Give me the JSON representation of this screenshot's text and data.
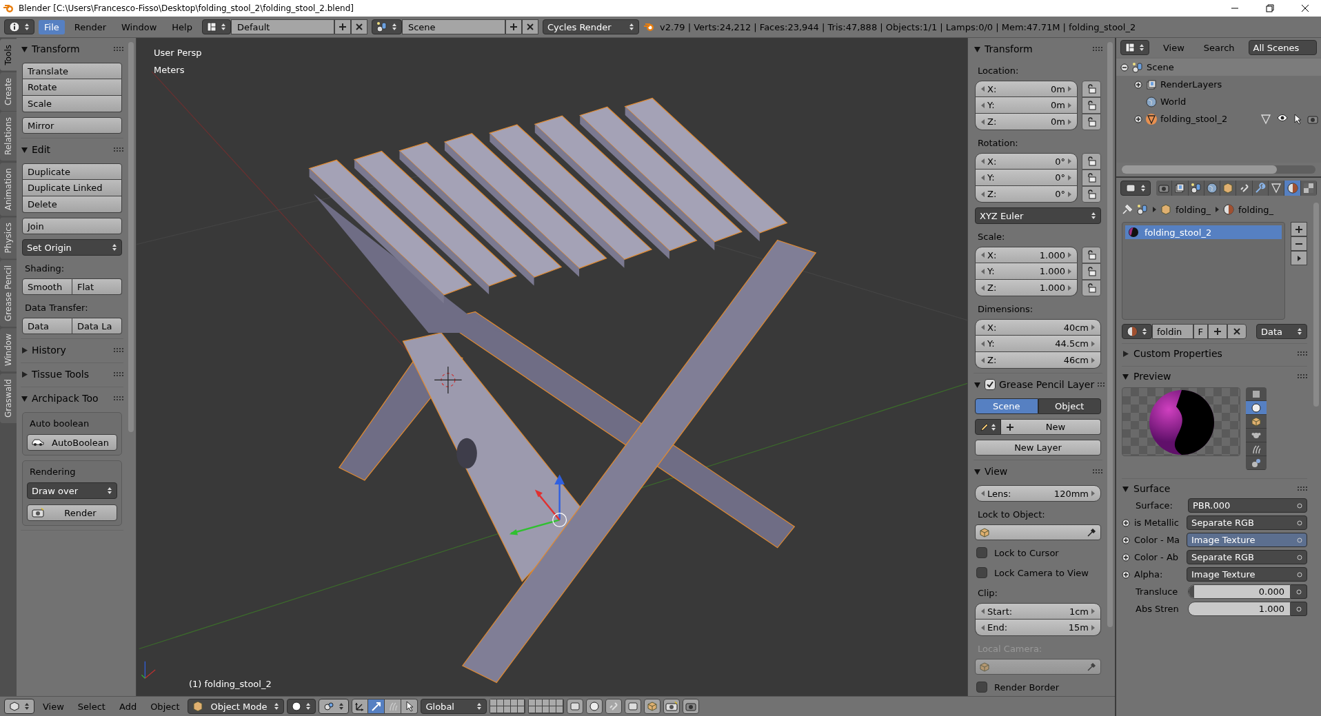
{
  "window": {
    "title": "Blender [C:\\Users\\Francesco-Fisso\\Desktop\\folding_stool_2\\folding_stool_2.blend]"
  },
  "info_header": {
    "menus": [
      {
        "label": "File",
        "selected": true
      },
      {
        "label": "Render",
        "selected": false
      },
      {
        "label": "Window",
        "selected": false
      },
      {
        "label": "Help",
        "selected": false
      }
    ],
    "layout": "Default",
    "scene": "Scene",
    "engine": "Cycles Render",
    "stats": "v2.79 | Verts:24,212 | Faces:23,944 | Tris:47,888 | Objects:1/1 | Lamps:0/0 | Mem:47.71M | folding_stool_2"
  },
  "tool_tabs": [
    {
      "label": "Tools",
      "selected": true
    },
    {
      "label": "Create",
      "selected": false
    },
    {
      "label": "Relations",
      "selected": false
    },
    {
      "label": "Animation",
      "selected": false
    },
    {
      "label": "Physics",
      "selected": false
    },
    {
      "label": "Grease Pencil",
      "selected": false
    },
    {
      "label": "Window",
      "selected": false
    },
    {
      "label": "Graswald",
      "selected": false
    }
  ],
  "tool_panels": [
    {
      "title": "Transform",
      "expanded": true,
      "items": [
        {
          "kind": "buttons",
          "buttons": [
            "Translate",
            "Rotate",
            "Scale"
          ]
        },
        {
          "kind": "buttons",
          "buttons": [
            "Mirror"
          ]
        }
      ]
    },
    {
      "title": "Edit",
      "expanded": true,
      "items": [
        {
          "kind": "buttons",
          "buttons": [
            "Duplicate",
            "Duplicate Linked",
            "Delete"
          ]
        },
        {
          "kind": "buttons",
          "buttons": [
            "Join"
          ]
        },
        {
          "kind": "dropdown",
          "value": "Set Origin"
        },
        {
          "kind": "label",
          "text": "Shading:"
        },
        {
          "kind": "row",
          "buttons": [
            "Smooth",
            "Flat"
          ]
        },
        {
          "kind": "label",
          "text": "Data Transfer:"
        },
        {
          "kind": "row",
          "buttons": [
            "Data",
            "Data La"
          ]
        }
      ]
    },
    {
      "title": "History",
      "expanded": false
    },
    {
      "title": "Tissue Tools",
      "expanded": false
    },
    {
      "title": "Archipack Too",
      "expanded": true,
      "items": [
        {
          "kind": "box",
          "items": [
            {
              "kind": "label",
              "text": "Auto boolean"
            },
            {
              "kind": "boolean_button",
              "label": "AutoBoolean"
            }
          ]
        },
        {
          "kind": "box",
          "items": [
            {
              "kind": "label",
              "text": "Rendering"
            },
            {
              "kind": "dropdown",
              "value": "Draw over"
            },
            {
              "kind": "render_button",
              "label": "Render"
            }
          ]
        }
      ]
    }
  ],
  "viewport": {
    "view_name": "User Persp",
    "units": "Meters",
    "object_label": "(1) folding_stool_2"
  },
  "n_panels": [
    {
      "title": "Transform",
      "expanded": true,
      "items": [
        {
          "kind": "label",
          "text": "Location:",
          "disabled": false
        },
        {
          "kind": "vector",
          "locks": true,
          "fields": [
            {
              "label": "X:",
              "value": "0m"
            },
            {
              "label": "Y:",
              "value": "0m"
            },
            {
              "label": "Z:",
              "value": "0m"
            }
          ]
        },
        {
          "kind": "label",
          "text": "Rotation:",
          "disabled": false
        },
        {
          "kind": "vector",
          "locks": true,
          "fields": [
            {
              "label": "X:",
              "value": "0°"
            },
            {
              "label": "Y:",
              "value": "0°"
            },
            {
              "label": "Z:",
              "value": "0°"
            }
          ]
        },
        {
          "kind": "dropdown",
          "value": "XYZ Euler"
        },
        {
          "kind": "label",
          "text": "Scale:",
          "disabled": false
        },
        {
          "kind": "vector",
          "locks": true,
          "fields": [
            {
              "label": "X:",
              "value": "1.000"
            },
            {
              "label": "Y:",
              "value": "1.000"
            },
            {
              "label": "Z:",
              "value": "1.000"
            }
          ]
        },
        {
          "kind": "label",
          "text": "Dimensions:",
          "disabled": false
        },
        {
          "kind": "vector",
          "locks": false,
          "fields": [
            {
              "label": "X:",
              "value": "40cm"
            },
            {
              "label": "Y:",
              "value": "44.5cm"
            },
            {
              "label": "Z:",
              "value": "46cm"
            }
          ]
        }
      ]
    },
    {
      "title": "Grease Pencil Layer",
      "checked": true,
      "expanded": true,
      "items": [
        {
          "kind": "tabs",
          "tabs": [
            {
              "label": "Scene",
              "selected": true
            },
            {
              "label": "Object",
              "selected": false
            }
          ]
        },
        {
          "kind": "new_row",
          "label": "New"
        },
        {
          "kind": "button",
          "label": "New Layer"
        }
      ]
    },
    {
      "title": "View",
      "expanded": true,
      "items": [
        {
          "kind": "vector",
          "locks": false,
          "fields": [
            {
              "label": "Lens:",
              "value": "120mm"
            }
          ]
        },
        {
          "kind": "label",
          "text": "Lock to Object:",
          "disabled": false
        },
        {
          "kind": "object_field",
          "disabled": false
        },
        {
          "kind": "checkbox",
          "label": "Lock to Cursor",
          "checked": false
        },
        {
          "kind": "checkbox",
          "label": "Lock Camera to View",
          "checked": false
        },
        {
          "kind": "label",
          "text": "Clip:",
          "disabled": false
        },
        {
          "kind": "vector",
          "locks": false,
          "fields": [
            {
              "label": "Start:",
              "value": "1cm"
            },
            {
              "label": "End:",
              "value": "15m"
            }
          ]
        },
        {
          "kind": "label",
          "text": "Local Camera:",
          "disabled": true
        },
        {
          "kind": "object_field",
          "disabled": true
        },
        {
          "kind": "checkbox",
          "label": "Render Border",
          "checked": false
        }
      ]
    }
  ],
  "outliner": {
    "menus": [
      "View",
      "Search"
    ],
    "filter": "All Scenes",
    "tree": [
      {
        "kind": "scene",
        "label": "Scene",
        "selected": true,
        "expanded": true,
        "children": [
          {
            "kind": "render_layers",
            "label": "RenderLayers",
            "selected": false,
            "expanded": false
          },
          {
            "kind": "world",
            "label": "World",
            "selected": false
          },
          {
            "kind": "object",
            "label": "folding_stool_2",
            "selected": false,
            "expanded": false
          }
        ]
      }
    ]
  },
  "properties": {
    "tabs": [
      {
        "selected": false
      },
      {
        "selected": false
      },
      {
        "selected": false
      },
      {
        "selected": false
      },
      {
        "selected": false
      },
      {
        "selected": false
      },
      {
        "selected": false
      },
      {
        "selected": false
      },
      {
        "selected": true
      },
      {
        "selected": false
      }
    ],
    "breadcrumb": [
      "folding_",
      "folding_"
    ],
    "slots": [
      {
        "label": "folding_stool_2",
        "selected": true
      }
    ],
    "datablock": {
      "name": "foldin",
      "users": "F",
      "link": "Data"
    },
    "panels": [
      {
        "title": "Custom Properties",
        "expanded": false
      },
      {
        "title": "Preview",
        "expanded": true
      },
      {
        "title": "Surface",
        "expanded": true
      }
    ],
    "preview_shapes": [
      {
        "selected": false
      },
      {
        "selected": true
      },
      {
        "selected": false
      },
      {
        "selected": false
      },
      {
        "selected": false
      },
      {
        "selected": false
      }
    ],
    "surface": [
      {
        "kind": "socket",
        "label": "Surface:",
        "value": "PBR.000",
        "expandable": false,
        "selected": false
      },
      {
        "kind": "socket",
        "label": "is Metallic",
        "value": "Separate RGB",
        "expandable": true,
        "selected": false
      },
      {
        "kind": "socket",
        "label": "Color - Ma",
        "value": "Image Texture",
        "expandable": true,
        "selected": true
      },
      {
        "kind": "socket",
        "label": "Color - Ab",
        "value": "Separate RGB",
        "expandable": true,
        "selected": false
      },
      {
        "kind": "socket",
        "label": "Alpha:",
        "value": "Image Texture",
        "expandable": true,
        "selected": false
      },
      {
        "kind": "slider",
        "label": "Transluce",
        "value": "0.000",
        "level": 0
      },
      {
        "kind": "number",
        "label": "Abs Stren",
        "value": "1.000"
      }
    ]
  },
  "view3d_header": {
    "menus": [
      "View",
      "Select",
      "Add",
      "Object"
    ],
    "mode": "Object Mode",
    "manipulators": [
      {
        "selected": false
      },
      {
        "selected": true
      },
      {
        "selected": false
      },
      {
        "selected": false
      }
    ],
    "orientation": "Global"
  }
}
